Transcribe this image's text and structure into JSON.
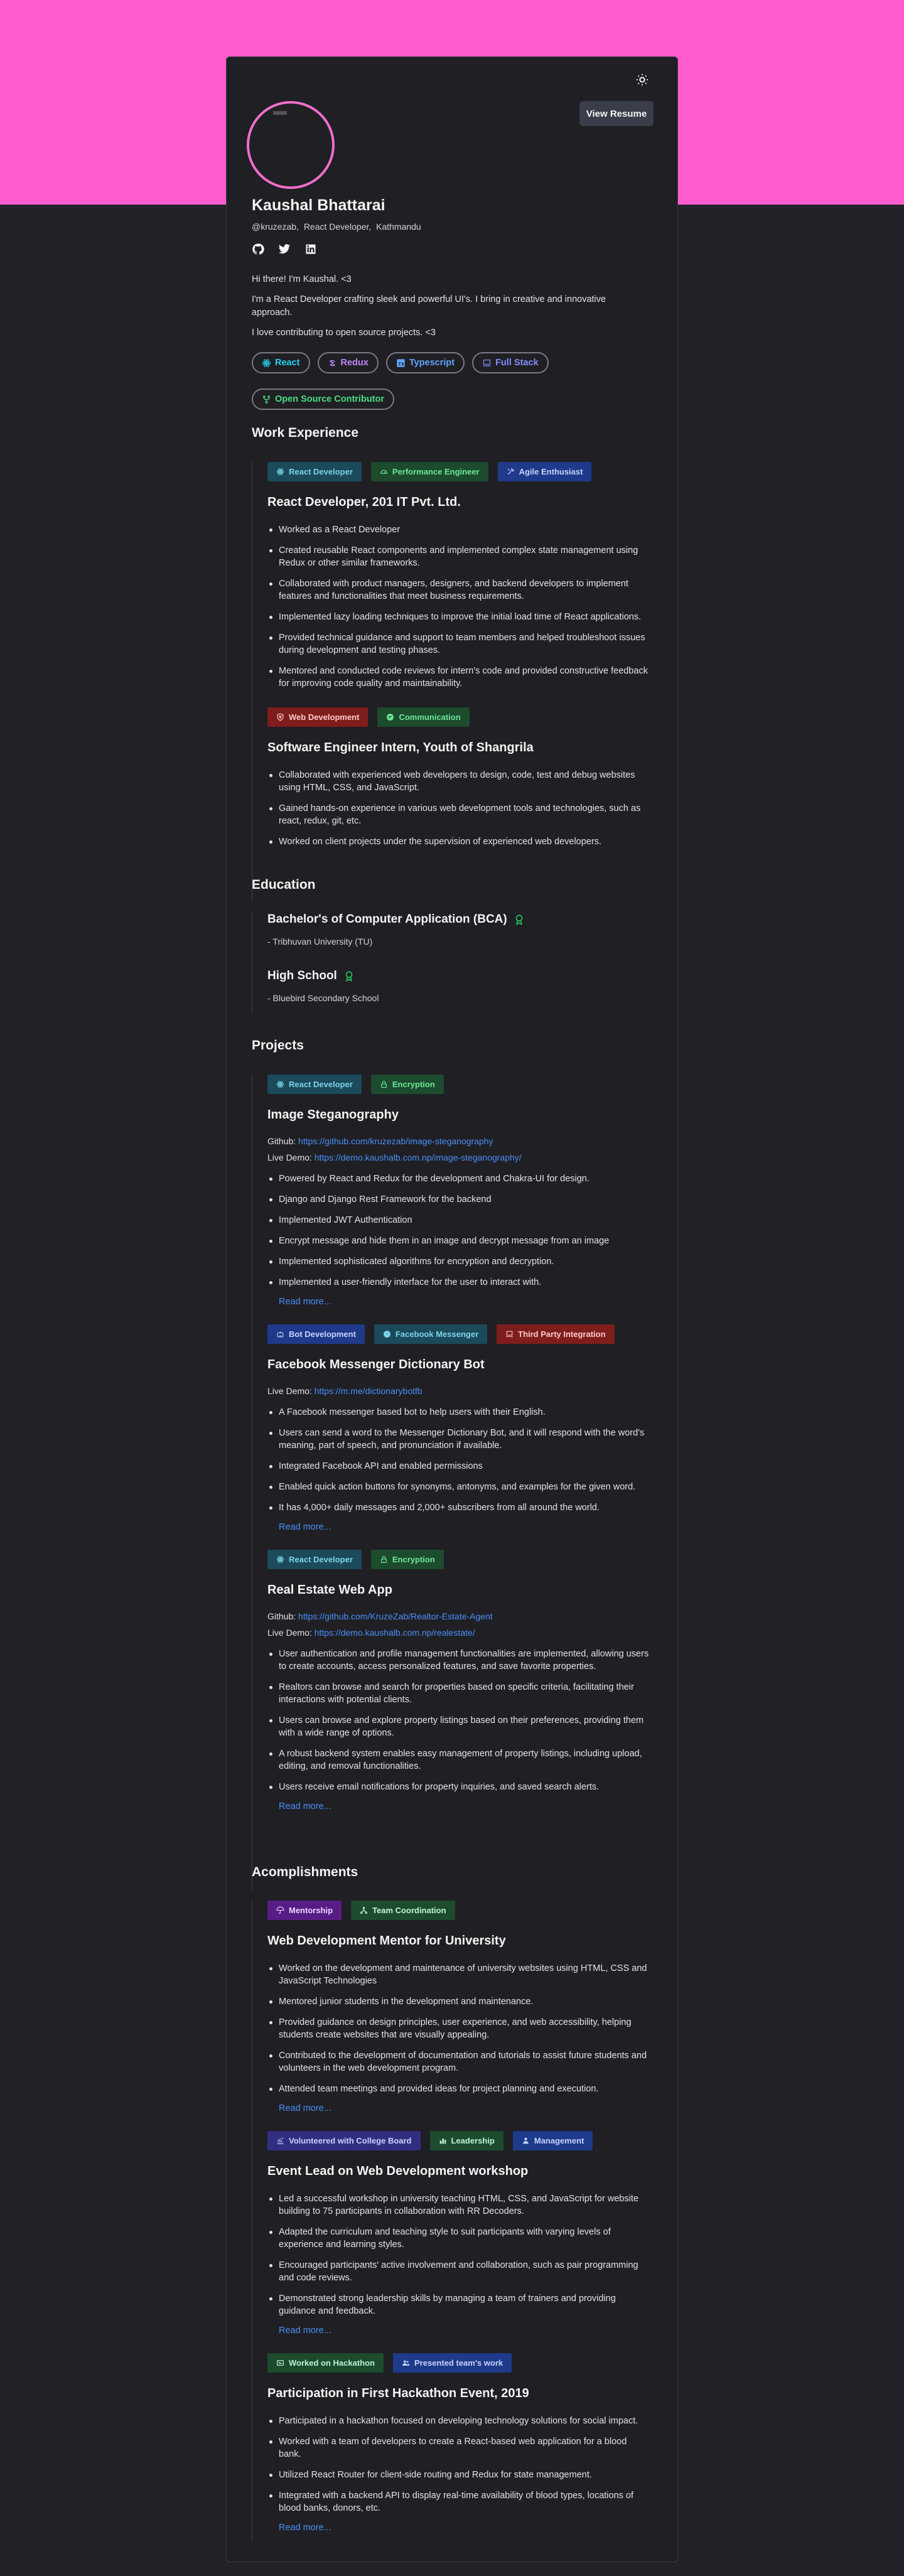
{
  "header": {
    "resume_label": "View Resume",
    "name": "Kaushal Bhattarai",
    "handle": "@kruzezab,",
    "role": "React Developer,",
    "location": "Kathmandu",
    "socials": [
      "github-icon",
      "twitter-icon",
      "linkedin-icon"
    ]
  },
  "bio": [
    "Hi there! I'm Kaushal. <3",
    "I'm a React Developer crafting sleek and powerful UI's. I bring in creative and innovative approach.",
    "I love contributing to open source projects. <3"
  ],
  "skills": [
    {
      "label": "React",
      "color": "#22d3ee",
      "icon": "react-icon"
    },
    {
      "label": "Redux",
      "color": "#c084fc",
      "icon": "redux-icon"
    },
    {
      "label": "Typescript",
      "color": "#60a5fa",
      "icon": "typescript-icon"
    },
    {
      "label": "Full Stack",
      "color": "#818cf8",
      "icon": "laptop-icon"
    },
    {
      "label": "Open Source Contributor",
      "color": "#4ade80",
      "icon": "git-fork-icon"
    }
  ],
  "sections": {
    "work": "Work Experience",
    "education": "Education",
    "projects": "Projects",
    "accomplishments": "Acomplishments"
  },
  "work": [
    {
      "tags": [
        {
          "label": "React Developer",
          "bg": "#1b4a5a",
          "fg": "#7dd3e8",
          "icon": "react-icon"
        },
        {
          "label": "Performance Engineer",
          "bg": "#1c4b2e",
          "fg": "#6ee79a",
          "icon": "gauge-icon"
        },
        {
          "label": "Agile Enthusiast",
          "bg": "#1f3a8a",
          "fg": "#c7d2fe",
          "icon": "tools-icon"
        }
      ],
      "title": "React Developer, 201 IT Pvt. Ltd.",
      "bullets": [
        "Worked as a React Developer",
        "Created reusable React components and implemented complex state management using Redux or other similar frameworks.",
        "Collaborated with product managers, designers, and backend developers to implement features and functionalities that meet business requirements.",
        "Implemented lazy loading techniques to improve the initial load time of React applications.",
        "Provided technical guidance and support to team members and helped troubleshoot issues during development and testing phases.",
        "Mentored and conducted code reviews for intern's code and provided constructive feedback for improving code quality and maintainability."
      ]
    },
    {
      "tags": [
        {
          "label": "Web Development",
          "bg": "#7f1d1d",
          "fg": "#fecaca",
          "icon": "shield-icon"
        },
        {
          "label": "Communication",
          "bg": "#1c4b2e",
          "fg": "#6ee79a",
          "icon": "chat-icon"
        }
      ],
      "title": "Software Engineer Intern, Youth of Shangrila",
      "bullets": [
        "Collaborated with experienced web developers to design, code, test and debug websites using HTML, CSS, and JavaScript.",
        "Gained hands-on experience in various web development tools and technologies, such as react, redux, git, etc.",
        "Worked on client projects under the supervision of experienced web developers."
      ]
    }
  ],
  "education": [
    {
      "title": "Bachelor's of Computer Application (BCA)",
      "sub": "- Tribhuvan University (TU)"
    },
    {
      "title": "High School",
      "sub": "- Bluebird Secondary School"
    }
  ],
  "projects": [
    {
      "tags": [
        {
          "label": "React Developer",
          "bg": "#1b4a5a",
          "fg": "#7dd3e8",
          "icon": "react-icon"
        },
        {
          "label": "Encryption",
          "bg": "#1c4b2e",
          "fg": "#6ee79a",
          "icon": "lock-icon"
        }
      ],
      "title": "Image Steganography",
      "github_label": "Github:",
      "github": "https://github.com/kruzezab/image-steganography",
      "demo_label": "Live Demo:",
      "demo": "https://demo.kaushalb.com.np/image-steganography/",
      "bullets": [
        "Powered by React and Redux for the development and Chakra-UI for design.",
        "Django and Django Rest Framework for the backend",
        "Implemented JWT Authentication",
        "Encrypt message and hide them in an image and decrypt message from an image",
        "Implemented sophisticated algorithms for encryption and decryption.",
        "Implemented a user-friendly interface for the user to interact with."
      ],
      "read_more": "Read more..."
    },
    {
      "tags": [
        {
          "label": "Bot Development",
          "bg": "#1f3a8a",
          "fg": "#c7d2fe",
          "icon": "robot-icon"
        },
        {
          "label": "Facebook Messenger",
          "bg": "#1b4a5a",
          "fg": "#7dd3e8",
          "icon": "messenger-icon"
        },
        {
          "label": "Third Party Integration",
          "bg": "#7f1d1d",
          "fg": "#fecaca",
          "icon": "laptop-icon"
        }
      ],
      "title": "Facebook Messenger Dictionary Bot",
      "demo_label": "Live Demo:",
      "demo": "https://m.me/dictionarybotfb",
      "bullets": [
        "A Facebook messenger based bot to help users with their English.",
        "Users can send a word to the Messenger Dictionary Bot, and it will respond with the word's meaning, part of speech, and pronunciation if available.",
        "Integrated Facebook API and enabled permissions",
        "Enabled quick action buttons for synonyms, antonyms, and examples for the given word.",
        "It has 4,000+ daily messages and 2,000+ subscribers from all around the world."
      ],
      "read_more": "Read more..."
    },
    {
      "tags": [
        {
          "label": "React Developer",
          "bg": "#1b4a5a",
          "fg": "#7dd3e8",
          "icon": "react-icon"
        },
        {
          "label": "Encryption",
          "bg": "#1c4b2e",
          "fg": "#6ee79a",
          "icon": "lock-icon"
        }
      ],
      "title": "Real Estate Web App",
      "github_label": "Github:",
      "github": "https://github.com/KruzeZab/Realtor-Estate-Agent",
      "demo_label": "Live Demo:",
      "demo": "https://demo.kaushalb.com.np/realestate/",
      "bullets": [
        "User authentication and profile management functionalities are implemented, allowing users to create accounts, access personalized features, and save favorite properties.",
        "Realtors can browse and search for properties based on specific criteria, facilitating their interactions with potential clients.",
        "Users can browse and explore property listings based on their preferences, providing them with a wide range of options.",
        "A robust backend system enables easy management of property listings, including upload, editing, and removal functionalities.",
        "Users receive email notifications for property inquiries, and saved search alerts."
      ],
      "read_more": "Read more..."
    }
  ],
  "accomplishments": [
    {
      "tags": [
        {
          "label": "Mentorship",
          "bg": "#581c87",
          "fg": "#e9d5ff",
          "icon": "umbrella-icon"
        },
        {
          "label": "Team Coordination",
          "bg": "#1c4b2e",
          "fg": "#bbf7d0",
          "icon": "network-icon"
        }
      ],
      "title": "Web Development Mentor for University",
      "bullets": [
        "Worked on the development and maintenance of university websites using HTML, CSS and JavaScript Technologies",
        "Mentored junior students in the development and maintenance.",
        "Provided guidance on design principles, user experience, and web accessibility, helping students create websites that are visually appealing.",
        "Contributed to the development of documentation and tutorials to assist future students and volunteers in the web development program.",
        "Attended team meetings and provided ideas for project planning and execution."
      ],
      "read_more": "Read more..."
    },
    {
      "tags": [
        {
          "label": "Volunteered with College Board",
          "bg": "#312e81",
          "fg": "#c7d2fe",
          "icon": "chart-icon"
        },
        {
          "label": "Leadership",
          "bg": "#1c4b2e",
          "fg": "#bbf7d0",
          "icon": "bar-chart-icon"
        },
        {
          "label": "Management",
          "bg": "#1e3a8a",
          "fg": "#c7d2fe",
          "icon": "user-icon"
        }
      ],
      "title": "Event Lead on Web Development workshop",
      "bullets": [
        "Led a successful workshop in university teaching HTML, CSS, and JavaScript for website building to 75 participants in collaboration with RR Decoders.",
        "Adapted the curriculum and teaching style to suit participants with varying levels of experience and learning styles.",
        "Encouraged participants' active involvement and collaboration, such as pair programming and code reviews.",
        "Demonstrated strong leadership skills by managing a team of trainers and providing guidance and feedback."
      ],
      "read_more": "Read more..."
    },
    {
      "tags": [
        {
          "label": "Worked on Hackathon",
          "bg": "#1c4b2e",
          "fg": "#bbf7d0",
          "icon": "card-icon"
        },
        {
          "label": "Presented team's work",
          "bg": "#1e3a8a",
          "fg": "#c7d2fe",
          "icon": "users-icon"
        }
      ],
      "title": "Participation in First Hackathon Event, 2019",
      "bullets": [
        "Participated in a hackathon focused on developing technology solutions for social impact.",
        "Worked with a team of developers to create a React-based web application for a blood bank.",
        "Utilized React Router for client-side routing and Redux for state management.",
        "Integrated with a backend API to display real-time availability of blood types, locations of blood banks, donors, etc."
      ],
      "read_more": "Read more..."
    }
  ]
}
